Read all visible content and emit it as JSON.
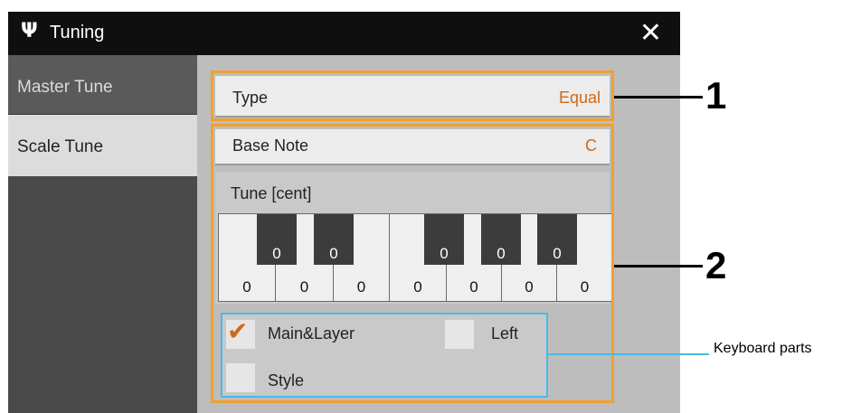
{
  "window": {
    "title": "Tuning",
    "title_icon": "tuning-fork-icon",
    "close_icon": "close-icon"
  },
  "sidebar": {
    "tabs": [
      {
        "label": "Master Tune"
      },
      {
        "label": "Scale Tune"
      }
    ]
  },
  "type_row": {
    "label": "Type",
    "value": "Equal"
  },
  "base_note": {
    "label": "Base Note",
    "value": "C"
  },
  "tune": {
    "label": "Tune [cent]",
    "black_keys": [
      "0",
      "0",
      "0",
      "0",
      "0"
    ],
    "white_keys": [
      "0",
      "0",
      "0",
      "0",
      "0",
      "0",
      "0"
    ]
  },
  "parts": {
    "main_layer": {
      "label": "Main&Layer",
      "checked": true
    },
    "left": {
      "label": "Left",
      "checked": false
    },
    "style": {
      "label": "Style",
      "checked": false
    }
  },
  "callouts": {
    "one": "1",
    "two": "2",
    "keyboard_parts": "Keyboard parts"
  },
  "colors": {
    "accent": "#d06818",
    "frame": "#f0a030",
    "parts_frame": "#4ab8e8"
  }
}
